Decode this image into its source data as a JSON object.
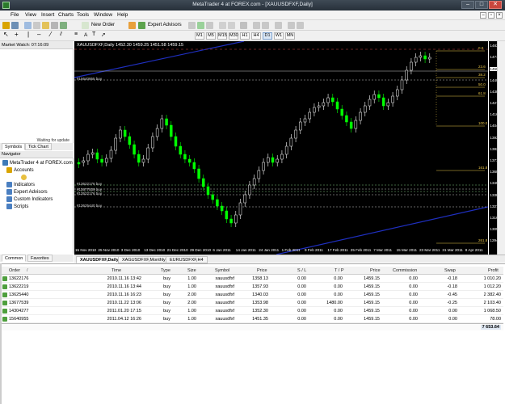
{
  "window": {
    "title": "MetaTrader 4 at FOREX.com - [XAUUSDFXF,Daily]"
  },
  "menu": [
    "File",
    "View",
    "Insert",
    "Charts",
    "Tools",
    "Window",
    "Help"
  ],
  "toolbar": {
    "new_order": "New Order",
    "expert_advisors": "Expert Advisors",
    "timeframes": [
      "M1",
      "M5",
      "M15",
      "M30",
      "H1",
      "H4",
      "D1",
      "W1",
      "MN"
    ],
    "active_timeframe": "D1"
  },
  "market_watch": {
    "header": "Market Watch: 07:16:09",
    "status": "Waiting for update",
    "tabs": [
      "Symbols",
      "Tick Chart"
    ]
  },
  "navigator": {
    "header": "Navigator",
    "items": [
      {
        "label": "MetaTrader 4 at FOREX.com",
        "color": "#3d7ab8"
      },
      {
        "label": "Accounts",
        "color": "#d9a400"
      },
      {
        "label": "",
        "color": "#e8c040"
      },
      {
        "label": "Indicators",
        "color": "#4a7fc1"
      },
      {
        "label": "Expert Advisors",
        "color": "#4a7fc1"
      },
      {
        "label": "Custom Indicators",
        "color": "#4a7fc1"
      },
      {
        "label": "Scripts",
        "color": "#4a7fc1"
      }
    ],
    "tabs": [
      "Common",
      "Favorites"
    ]
  },
  "chart": {
    "title": "XAUUSDFXF,Daily  1452.30 1459.25 1451.58 1459.15",
    "colors": {
      "background": "#000000",
      "bull": "#ffffff",
      "bear": "#00ff00",
      "trendline": "#1f2fbf",
      "fib": "#e8c54a"
    },
    "price_labels": [
      "1483.00",
      "1471.90",
      "1460.50",
      "1449.20",
      "1438.30",
      "1427.00",
      "1416.10",
      "1404.70",
      "1393.50",
      "1382.30",
      "1371.40",
      "1360.30",
      "1349.30",
      "1338.30",
      "1327.20",
      "1316.20",
      "1305.20",
      "1294.20"
    ],
    "current_price": "1459.15",
    "time_labels": [
      "15 Nov 2010",
      "25 Nov 2010",
      "3 Dec 2010",
      "13 Dec 2010",
      "21 Dec 2010",
      "29 Dec 2010",
      "6 Jan 2011",
      "14 Jan 2011",
      "24 Jan 2011",
      "1 Feb 2011",
      "9 Feb 2011",
      "17 Feb 2011",
      "25 Feb 2011",
      "7 Mar 2011",
      "15 Mar 2011",
      "23 Mar 2011",
      "31 Mar 2011",
      "8 Apr 2011"
    ],
    "order_labels": [
      "#15640955 buy",
      "#13622176 buy",
      "#13677539 buy",
      "#13522176 buy",
      "#13625440 buy"
    ],
    "fib_levels": [
      "0.0",
      "23.6",
      "38.2",
      "50.0",
      "61.8",
      "100.0",
      "161.8",
      "261.8"
    ]
  },
  "chart_tabs": [
    "XAUUSDFXF,Daily",
    "XAGUSDFXF,Monthly",
    "EURUSDFXF,H4"
  ],
  "trades": {
    "columns": [
      "Order",
      "Time",
      "Type",
      "Size",
      "Symbol",
      "Price",
      "S / L",
      "T / P",
      "Price",
      "Commission",
      "Swap",
      "Profit"
    ],
    "rows": [
      {
        "order": "13622176",
        "time": "2010.11.16 13:42",
        "type": "buy",
        "size": "1.00",
        "symbol": "xauusdfxf",
        "price": "1358.13",
        "sl": "0.00",
        "tp": "0.00",
        "cur": "1459.15",
        "commission": "0.00",
        "swap": "-0.18",
        "profit": "1 010.20"
      },
      {
        "order": "13622219",
        "time": "2010.11.16 13:44",
        "type": "buy",
        "size": "1.00",
        "symbol": "xauusdfxf",
        "price": "1357.93",
        "sl": "0.00",
        "tp": "0.00",
        "cur": "1459.15",
        "commission": "0.00",
        "swap": "-0.18",
        "profit": "1 012.20"
      },
      {
        "order": "13625440",
        "time": "2010.11.16 16:23",
        "type": "buy",
        "size": "2.00",
        "symbol": "xauusdfxf",
        "price": "1340.03",
        "sl": "0.00",
        "tp": "0.00",
        "cur": "1459.15",
        "commission": "0.00",
        "swap": "-0.45",
        "profit": "2 382.40"
      },
      {
        "order": "13677539",
        "time": "2010.11.22 13:06",
        "type": "buy",
        "size": "2.00",
        "symbol": "xauusdfxf",
        "price": "1353.98",
        "sl": "0.00",
        "tp": "1480.00",
        "cur": "1459.15",
        "commission": "0.00",
        "swap": "-0.25",
        "profit": "2 103.40"
      },
      {
        "order": "14304277",
        "time": "2011.01.20 17:15",
        "type": "buy",
        "size": "1.00",
        "symbol": "xauusdfxf",
        "price": "1352.30",
        "sl": "0.00",
        "tp": "0.00",
        "cur": "1459.15",
        "commission": "0.00",
        "swap": "0.00",
        "profit": "1 068.50"
      },
      {
        "order": "15640955",
        "time": "2011.04.12 16:26",
        "type": "buy",
        "size": "1.00",
        "symbol": "xauusdfxf",
        "price": "1451.35",
        "sl": "0.00",
        "tp": "0.00",
        "cur": "1459.15",
        "commission": "0.00",
        "swap": "0.00",
        "profit": "78.00"
      }
    ],
    "total_profit": "7 653.64"
  }
}
